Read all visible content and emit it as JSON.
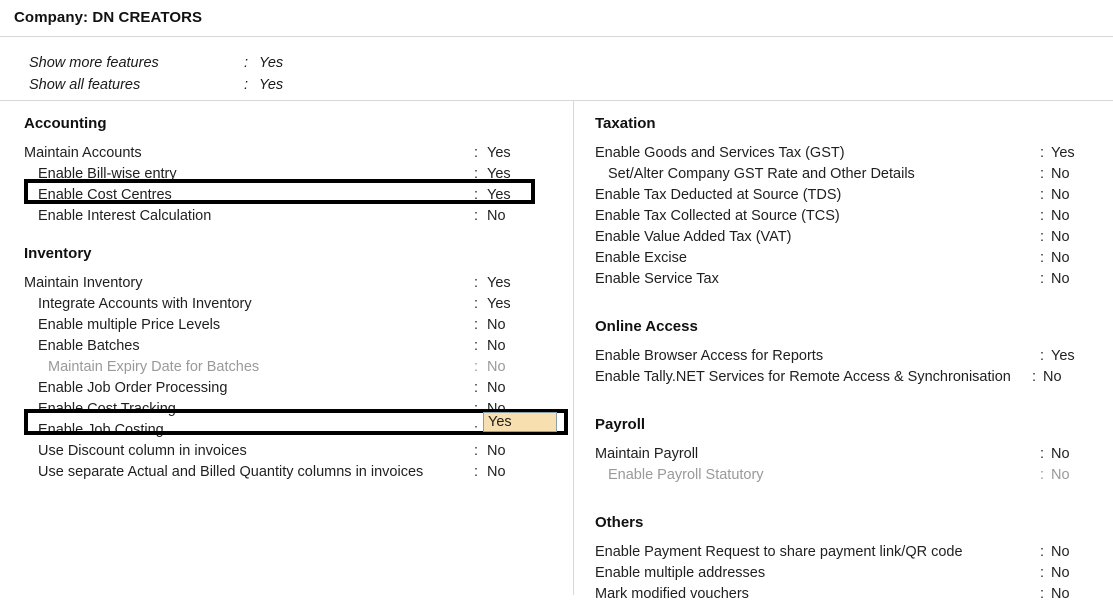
{
  "header": {
    "title": "Company: DN CREATORS"
  },
  "show_features": [
    {
      "label": "Show more features",
      "separator": ":",
      "value": "Yes"
    },
    {
      "label": "Show all features",
      "separator": ":",
      "value": "Yes"
    }
  ],
  "colors": {
    "focus_border": "#000000",
    "selected_field_bg": "#f8dfb0",
    "selected_field_border": "#8ba0a8",
    "disabled_text": "#9a9a9a",
    "rule": "#d8d8d8"
  },
  "left_column": {
    "sections": [
      {
        "heading": "Accounting",
        "rows": [
          {
            "label": "Maintain Accounts",
            "separator": ":",
            "value": "Yes",
            "indent": 0,
            "disabled": false,
            "focused": false
          },
          {
            "label": "Enable Bill-wise entry",
            "separator": ":",
            "value": "Yes",
            "indent": 1,
            "disabled": false,
            "focused": false
          },
          {
            "label": "Enable Cost Centres",
            "separator": ":",
            "value": "Yes",
            "indent": 1,
            "disabled": false,
            "focused": true
          },
          {
            "label": "Enable Interest Calculation",
            "separator": ":",
            "value": "No",
            "indent": 1,
            "disabled": false,
            "focused": false
          }
        ]
      },
      {
        "heading": "Inventory",
        "rows": [
          {
            "label": "Maintain Inventory",
            "separator": ":",
            "value": "Yes",
            "indent": 0,
            "disabled": false,
            "focused": false
          },
          {
            "label": "Integrate Accounts with Inventory",
            "separator": ":",
            "value": "Yes",
            "indent": 1,
            "disabled": false,
            "focused": false
          },
          {
            "label": "Enable multiple Price Levels",
            "separator": ":",
            "value": "No",
            "indent": 1,
            "disabled": false,
            "focused": false
          },
          {
            "label": "Enable Batches",
            "separator": ":",
            "value": "No",
            "indent": 1,
            "disabled": false,
            "focused": false
          },
          {
            "label": "Maintain Expiry Date for Batches",
            "separator": ":",
            "value": "No",
            "indent": 2,
            "disabled": true,
            "focused": false
          },
          {
            "label": "Enable Job Order Processing",
            "separator": ":",
            "value": "No",
            "indent": 1,
            "disabled": false,
            "focused": false
          },
          {
            "label": "Enable Cost Tracking",
            "separator": ":",
            "value": "No",
            "indent": 1,
            "disabled": false,
            "focused": false
          },
          {
            "label": "Enable Job Costing",
            "separator": ":",
            "value": "Yes",
            "indent": 1,
            "disabled": false,
            "focused": true
          },
          {
            "label": "Use Discount column in invoices",
            "separator": ":",
            "value": "No",
            "indent": 1,
            "disabled": false,
            "focused": false
          },
          {
            "label": "Use separate Actual and Billed Quantity columns in invoices",
            "separator": ":",
            "value": "No",
            "indent": 1,
            "disabled": false,
            "focused": false
          }
        ]
      }
    ]
  },
  "right_column": {
    "sections": [
      {
        "heading": "Taxation",
        "rows": [
          {
            "label": "Enable Goods and Services Tax (GST)",
            "separator": ":",
            "value": "Yes",
            "indent": 0,
            "disabled": false
          },
          {
            "label": "Set/Alter Company GST Rate and Other Details",
            "separator": ":",
            "value": "No",
            "indent": 1,
            "disabled": false
          },
          {
            "label": "Enable Tax Deducted at Source (TDS)",
            "separator": ":",
            "value": "No",
            "indent": 0,
            "disabled": false
          },
          {
            "label": "Enable Tax Collected at Source (TCS)",
            "separator": ":",
            "value": "No",
            "indent": 0,
            "disabled": false
          },
          {
            "label": "Enable Value Added Tax (VAT)",
            "separator": ":",
            "value": "No",
            "indent": 0,
            "disabled": false
          },
          {
            "label": "Enable Excise",
            "separator": ":",
            "value": "No",
            "indent": 0,
            "disabled": false
          },
          {
            "label": "Enable Service Tax",
            "separator": ":",
            "value": "No",
            "indent": 0,
            "disabled": false
          }
        ]
      },
      {
        "heading": "Online Access",
        "rows": [
          {
            "label": "Enable Browser Access for Reports",
            "separator": ":",
            "value": "Yes",
            "indent": 0,
            "disabled": false
          },
          {
            "label": "Enable Tally.NET Services for Remote Access & Synchronisation",
            "separator": ":",
            "value": "No",
            "indent": 0,
            "disabled": false,
            "tight": true
          }
        ]
      },
      {
        "heading": "Payroll",
        "rows": [
          {
            "label": "Maintain Payroll",
            "separator": ":",
            "value": "No",
            "indent": 0,
            "disabled": false
          },
          {
            "label": "Enable Payroll Statutory",
            "separator": ":",
            "value": "No",
            "indent": 1,
            "disabled": true
          }
        ]
      },
      {
        "heading": "Others",
        "rows": [
          {
            "label": "Enable Payment Request to share payment link/QR code",
            "separator": ":",
            "value": "No",
            "indent": 0,
            "disabled": false
          },
          {
            "label": "Enable multiple addresses",
            "separator": ":",
            "value": "No",
            "indent": 0,
            "disabled": false
          },
          {
            "label": "Mark modified vouchers",
            "separator": ":",
            "value": "No",
            "indent": 0,
            "disabled": false
          }
        ]
      }
    ]
  },
  "focused_field": {
    "value": "Yes"
  }
}
